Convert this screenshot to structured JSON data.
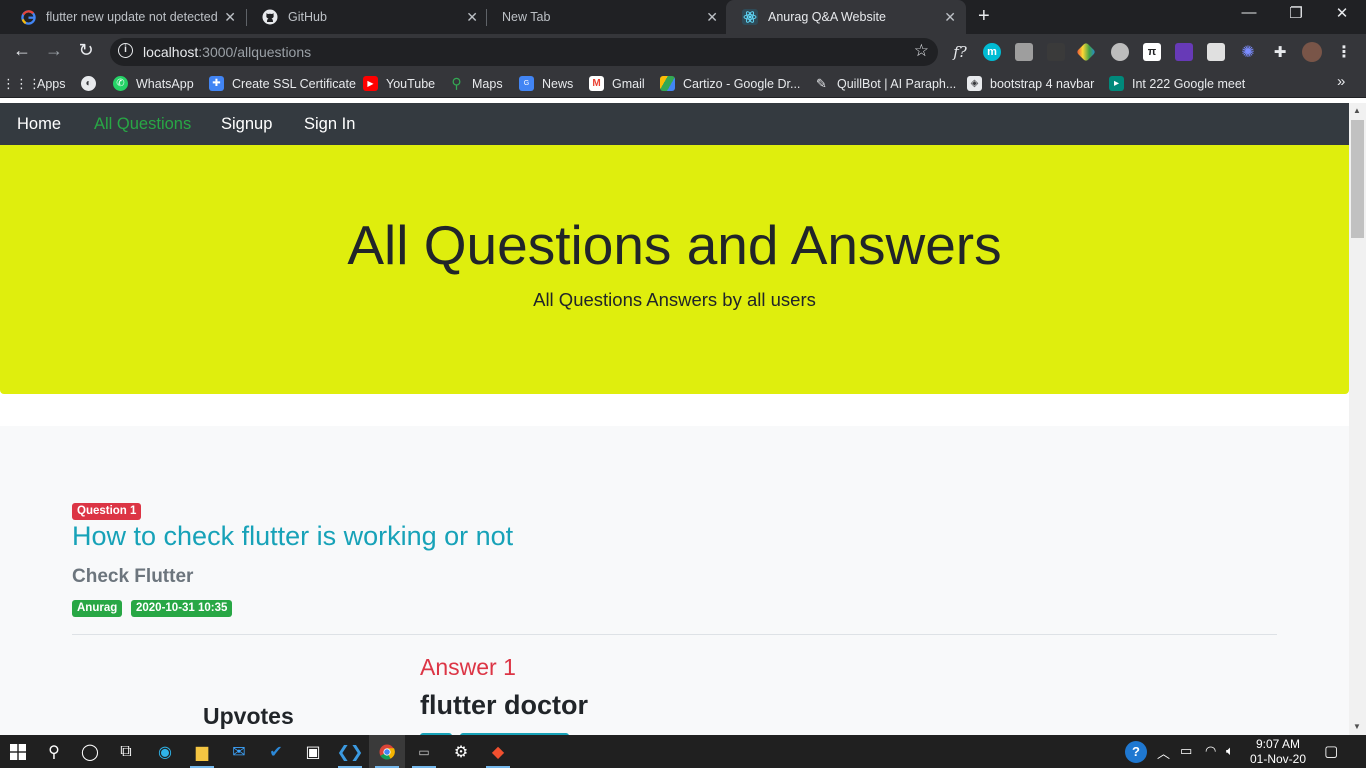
{
  "browser": {
    "tabs": [
      {
        "title": "flutter new update not detected",
        "favicon": "google-icon"
      },
      {
        "title": "GitHub",
        "favicon": "github-icon"
      },
      {
        "title": "New Tab",
        "favicon": ""
      },
      {
        "title": "Anurag Q&A Website",
        "favicon": "react-icon"
      }
    ],
    "active_tab": 3,
    "url_host": "localhost",
    "url_path": ":3000/allquestions",
    "bookmarks": [
      {
        "label": "Apps",
        "icon": "apps-grid-icon"
      },
      {
        "label": "",
        "icon": "globe-icon"
      },
      {
        "label": "WhatsApp",
        "icon": "whatsapp-icon"
      },
      {
        "label": "Create SSL Certificate",
        "icon": "puzzle-icon"
      },
      {
        "label": "YouTube",
        "icon": "youtube-icon"
      },
      {
        "label": "Maps",
        "icon": "maps-icon"
      },
      {
        "label": "News",
        "icon": "news-icon"
      },
      {
        "label": "Gmail",
        "icon": "gmail-icon"
      },
      {
        "label": "Cartizo - Google Dr...",
        "icon": "drive-icon"
      },
      {
        "label": "QuillBot | AI Paraph...",
        "icon": "quillbot-icon"
      },
      {
        "label": "bootstrap 4 navbar",
        "icon": "bootstrap-icon"
      },
      {
        "label": "Int 222 Google meet",
        "icon": "meet-icon"
      }
    ],
    "more_bookmarks": "»"
  },
  "site": {
    "nav": [
      {
        "label": "Home",
        "active": false
      },
      {
        "label": "All Questions",
        "active": true
      },
      {
        "label": "Signup",
        "active": false
      },
      {
        "label": "Sign In",
        "active": false
      }
    ],
    "hero_title": "All Questions and Answers",
    "hero_subtitle": "All Questions Answers by all users",
    "hero_color": "#dfee0d",
    "question": {
      "badge": "Question 1",
      "title": "How to check flutter is working or not",
      "subtitle": "Check Flutter",
      "author": "Anurag",
      "date": "2020-10-31 10:35"
    },
    "answer": {
      "heading": "Answer 1",
      "text": "flutter doctor"
    },
    "upvotes_label": "Upvotes"
  },
  "taskbar": {
    "time": "9:07 AM",
    "date": "01-Nov-20"
  },
  "colors": {
    "accent_green": "#28a745",
    "accent_red": "#dc3545",
    "accent_teal": "#17a2b8",
    "navbar_dark": "#343a40"
  }
}
